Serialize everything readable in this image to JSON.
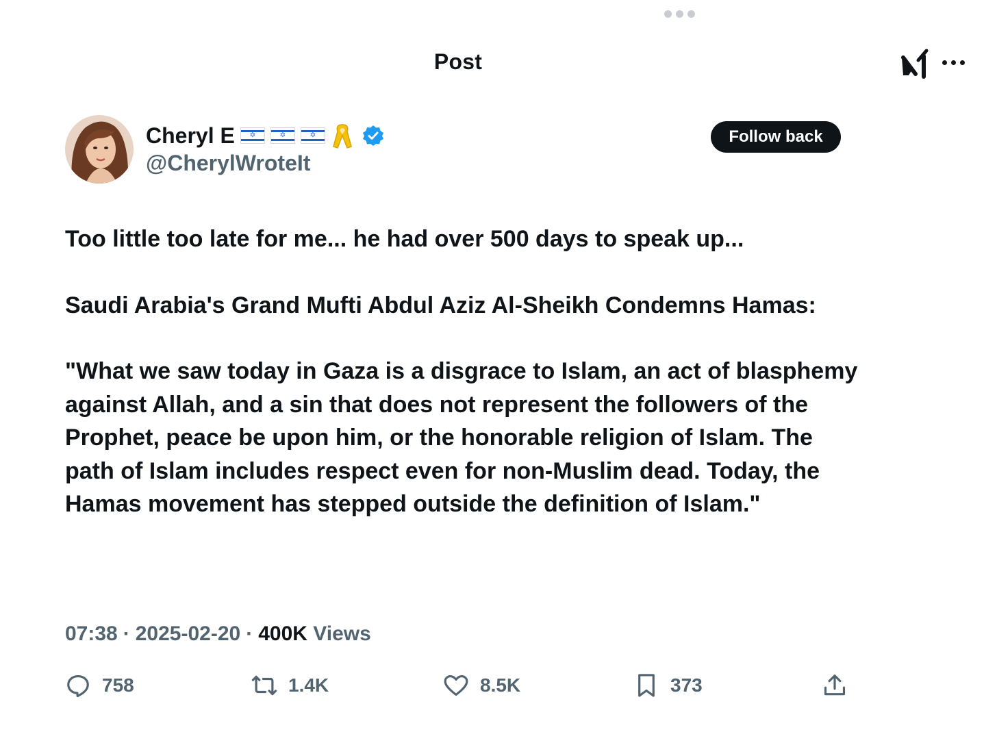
{
  "header": {
    "title": "Post"
  },
  "post": {
    "author": {
      "name": "Cheryl E",
      "handle": "@CherylWroteIt",
      "flags_count": 3,
      "verified": true
    },
    "follow_label": "Follow back",
    "paragraphs": [
      "Too little too late for me... he had over 500 days to speak up...",
      "Saudi Arabia's Grand Mufti Abdul Aziz Al-Sheikh Condemns Hamas:",
      "\"What we saw today in Gaza is a disgrace to Islam, an act of blasphemy against Allah, and a sin that does not represent the followers of the Prophet, peace be upon him, or the honorable religion of Islam. The path of Islam includes respect even for non-Muslim dead. Today, the Hamas movement has stepped outside the definition of Islam.\""
    ],
    "meta": {
      "time": "07:38",
      "date": "2025-02-20",
      "views_count": "400K",
      "views_label": "Views",
      "separator": "·"
    },
    "actions": {
      "replies": "758",
      "reposts": "1.4K",
      "likes": "8.5K",
      "bookmarks": "373"
    }
  },
  "icons": {
    "top_handle": "more-dots-icon",
    "grok": "grok-icon",
    "more": "more-horizontal-icon",
    "verified": "verified-badge-icon",
    "ribbon": "yellow-ribbon-icon",
    "flag": "israel-flag-icon",
    "reply": "reply-icon",
    "repost": "repost-icon",
    "like": "heart-icon",
    "bookmark": "bookmark-icon",
    "share": "share-icon"
  },
  "colors": {
    "text": "#0f1419",
    "secondary": "#536471",
    "verified": "#1d9bf0",
    "button_bg": "#0f1419",
    "button_text": "#ffffff"
  }
}
